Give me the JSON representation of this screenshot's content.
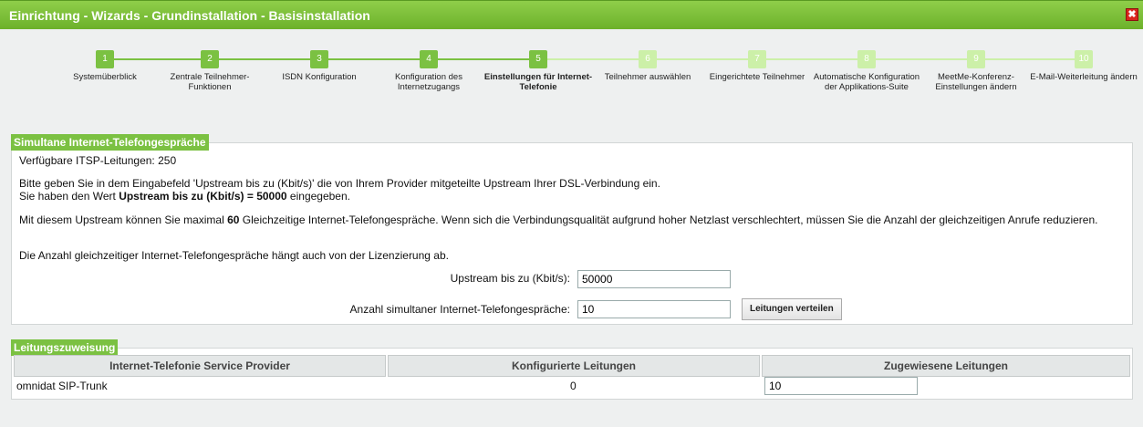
{
  "window": {
    "title": "Einrichtung - Wizards - Grundinstallation - Basisinstallation",
    "close_glyph": "✖"
  },
  "wizard": {
    "steps": [
      {
        "num": "1",
        "label": "Systemüberblick",
        "state": "done"
      },
      {
        "num": "2",
        "label": "Zentrale Teilnehmer-Funktionen",
        "state": "done"
      },
      {
        "num": "3",
        "label": "ISDN Konfiguration",
        "state": "done"
      },
      {
        "num": "4",
        "label": "Konfiguration des Internetzugangs",
        "state": "done"
      },
      {
        "num": "5",
        "label": "Einstellungen für Internet-Telefonie",
        "state": "active"
      },
      {
        "num": "6",
        "label": "Teilnehmer auswählen",
        "state": "todo"
      },
      {
        "num": "7",
        "label": "Eingerichtete Teilnehmer",
        "state": "todo"
      },
      {
        "num": "8",
        "label": "Automatische Konfiguration der Applikations-Suite",
        "state": "todo"
      },
      {
        "num": "9",
        "label": "MeetMe-Konferenz-Einstellungen ändern",
        "state": "todo"
      },
      {
        "num": "10",
        "label": "E-Mail-Weiterleitung ändern",
        "state": "todo"
      }
    ]
  },
  "simultan": {
    "legend": "Simultane Internet-Telefongespräche",
    "available": "Verfügbare ITSP-Leitungen: 250",
    "hint_line1": "Bitte geben Sie in dem Eingabefeld 'Upstream bis zu (Kbit/s)' die von Ihrem Provider mitgeteilte Upstream Ihrer DSL-Verbindung ein.",
    "hint_line2_prefix": "Sie haben den Wert ",
    "hint_line2_bold": "Upstream bis zu (Kbit/s) = 50000",
    "hint_line2_suffix": " eingegeben.",
    "max_prefix": "Mit diesem Upstream können Sie maximal ",
    "max_bold": "60",
    "max_suffix": " Gleichzeitige Internet-Telefongespräche. Wenn sich die Verbindungsqualität aufgrund hoher Netzlast verschlechtert, müssen Sie die Anzahl der gleichzeitigen Anrufe reduzieren.",
    "license_note": "Die Anzahl gleichzeitiger Internet-Telefongespräche hängt auch von der Lizenzierung ab.",
    "upstream_label": "Upstream bis zu (Kbit/s):",
    "upstream_value": "50000",
    "count_label": "Anzahl simultaner Internet-Telefongespräche:",
    "count_value": "10",
    "distribute_button": "Leitungen verteilen"
  },
  "zuweisung": {
    "legend": "Leitungszuweisung",
    "headers": [
      "Internet-Telefonie Service Provider",
      "Konfigurierte Leitungen",
      "Zugewiesene Leitungen"
    ],
    "rows": [
      {
        "provider": "omnidat SIP-Trunk",
        "configured": "0",
        "assigned": "10"
      }
    ]
  }
}
